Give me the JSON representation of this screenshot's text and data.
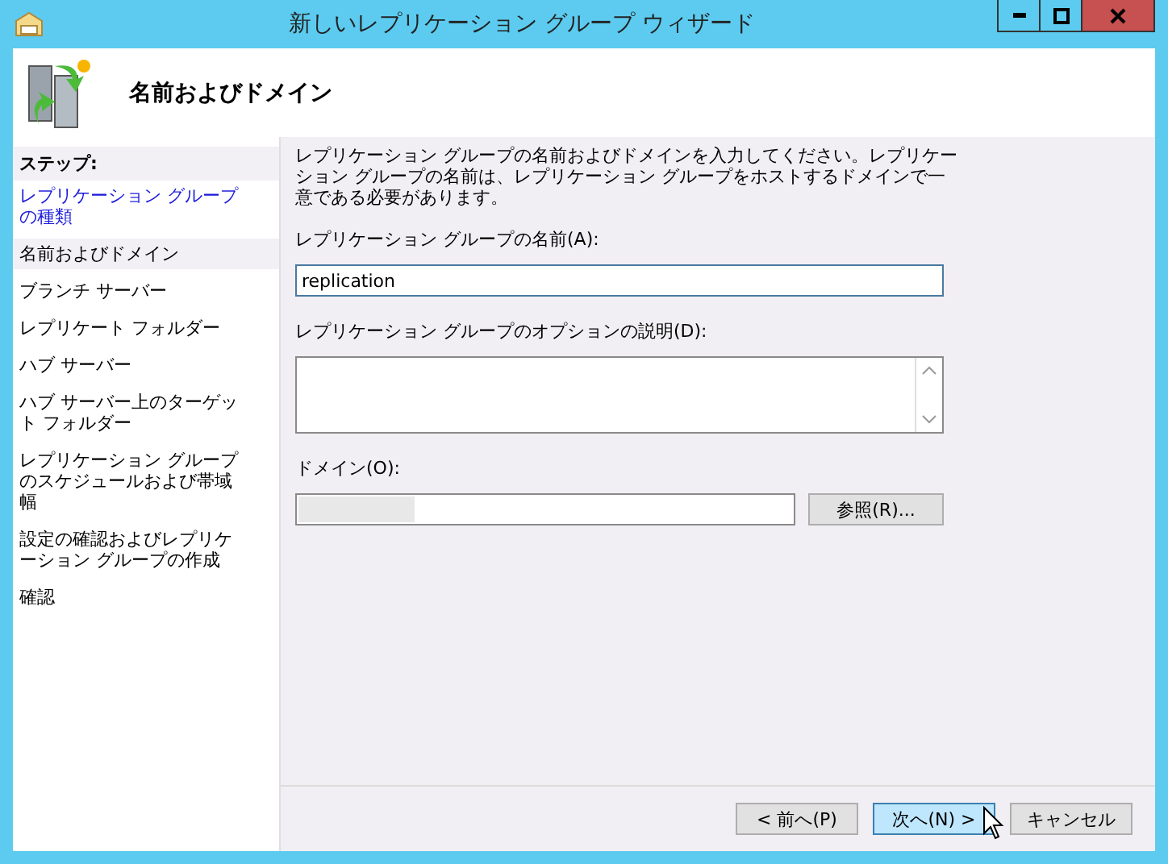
{
  "window": {
    "title": "新しいレプリケーション グループ ウィザード"
  },
  "header": {
    "title": "名前およびドメイン"
  },
  "steps": {
    "title": "ステップ:",
    "items": [
      {
        "label": "レプリケーション グループの種類",
        "selected": false,
        "done": true
      },
      {
        "label": "名前およびドメイン",
        "selected": true,
        "done": false
      },
      {
        "label": "ブランチ サーバー",
        "selected": false,
        "done": false
      },
      {
        "label": "レプリケート フォルダー",
        "selected": false,
        "done": false
      },
      {
        "label": "ハブ サーバー",
        "selected": false,
        "done": false
      },
      {
        "label": "ハブ サーバー上のターゲット フォルダー",
        "selected": false,
        "done": false
      },
      {
        "label": "レプリケーション グループのスケジュールおよび帯域幅",
        "selected": false,
        "done": false
      },
      {
        "label": "設定の確認およびレプリケーション グループの作成",
        "selected": false,
        "done": false
      },
      {
        "label": "確認",
        "selected": false,
        "done": false
      }
    ]
  },
  "intro": "レプリケーション グループの名前およびドメインを入力してください。レプリケーション グループの名前は、レプリケーション グループをホストするドメインで一意である必要があります。",
  "name_field": {
    "label": "レプリケーション グループの名前(A):",
    "value": "replication"
  },
  "description_field": {
    "label": "レプリケーション グループのオプションの説明(D):"
  },
  "domain_field": {
    "label": "ドメイン(O):",
    "browse_button": "参照(R)..."
  },
  "buttons": [
    {
      "label": "< 前へ(P)",
      "highlighted": false
    },
    {
      "label": "次へ(N) >",
      "highlighted": true
    },
    {
      "label": "キャンセル",
      "highlighted": false
    }
  ]
}
